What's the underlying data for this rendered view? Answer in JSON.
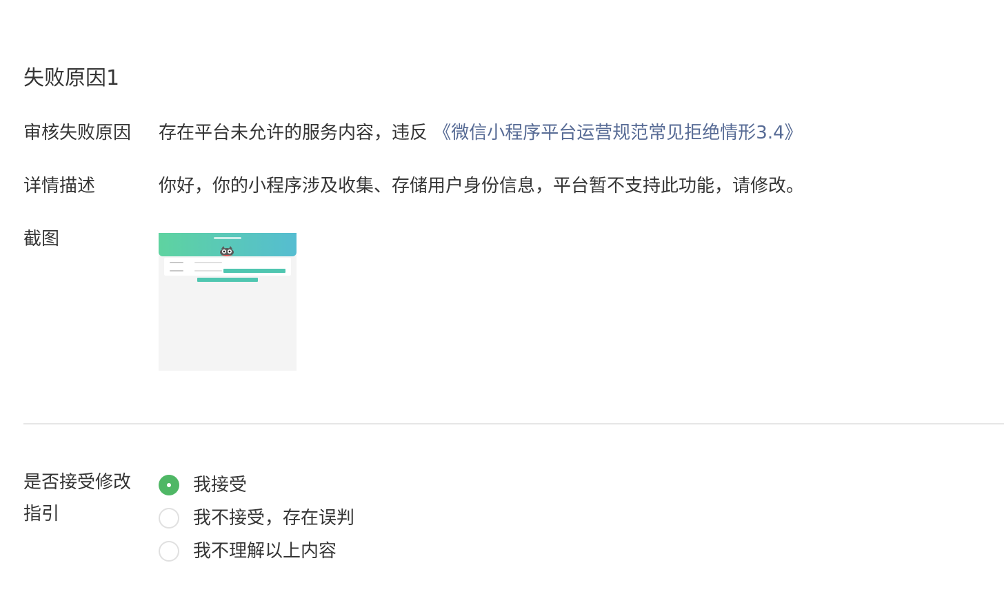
{
  "failure": {
    "title": "失败原因1",
    "reason_label": "审核失败原因",
    "reason_text": "存在平台未允许的服务内容，违反",
    "reason_link": "《微信小程序平台运营规范常见拒绝情形3.4》",
    "detail_label": "详情描述",
    "detail_text": "你好，你的小程序涉及收集、存储用户身份信息，平台暂不支持此功能，请修改。",
    "screenshot_label": "截图"
  },
  "acceptance": {
    "label": "是否接受修改指引",
    "options": [
      {
        "label": "我接受",
        "checked": true
      },
      {
        "label": "我不接受，存在误判",
        "checked": false
      },
      {
        "label": "我不理解以上内容",
        "checked": false
      }
    ]
  },
  "colors": {
    "link": "#576b95",
    "radio_checked": "#4fb765",
    "thumbnail_gradient_start": "#5ed3a0",
    "thumbnail_gradient_end": "#55bdd1"
  }
}
